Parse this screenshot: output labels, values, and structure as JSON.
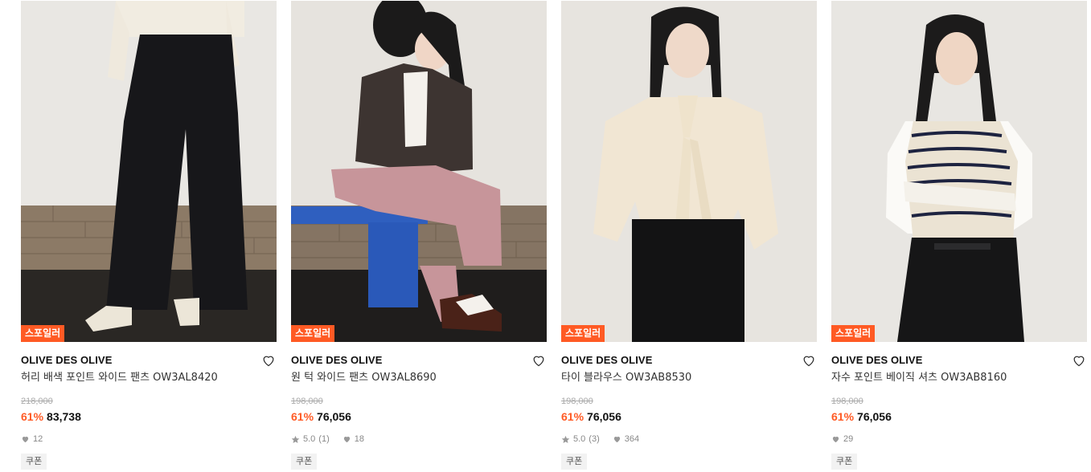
{
  "badge_label": "스포일러",
  "coupon_label": "쿠폰",
  "products": [
    {
      "brand": "OLIVE DES OLIVE",
      "name": "허리 배색 포인트 와이드 팬츠 OW3AL8420",
      "original_price": "218,000",
      "discount": "61%",
      "price": "83,738",
      "rating": null,
      "reviews": null,
      "likes": "12"
    },
    {
      "brand": "OLIVE DES OLIVE",
      "name": "원 턱 와이드 팬츠 OW3AL8690",
      "original_price": "198,000",
      "discount": "61%",
      "price": "76,056",
      "rating": "5.0",
      "reviews": "(1)",
      "likes": "18"
    },
    {
      "brand": "OLIVE DES OLIVE",
      "name": "타이 블라우스 OW3AB8530",
      "original_price": "198,000",
      "discount": "61%",
      "price": "76,056",
      "rating": "5.0",
      "reviews": "(3)",
      "likes": "364"
    },
    {
      "brand": "OLIVE DES OLIVE",
      "name": "자수 포인트 베이직 셔츠 OW3AB8160",
      "original_price": "198,000",
      "discount": "61%",
      "price": "76,056",
      "rating": null,
      "reviews": null,
      "likes": "29"
    }
  ],
  "icons": {
    "wishlist": "heart-outline-icon",
    "likes": "heart-filled-icon",
    "rating": "star-icon"
  },
  "colors": {
    "accent": "#ff5a24",
    "muted": "#888888"
  }
}
